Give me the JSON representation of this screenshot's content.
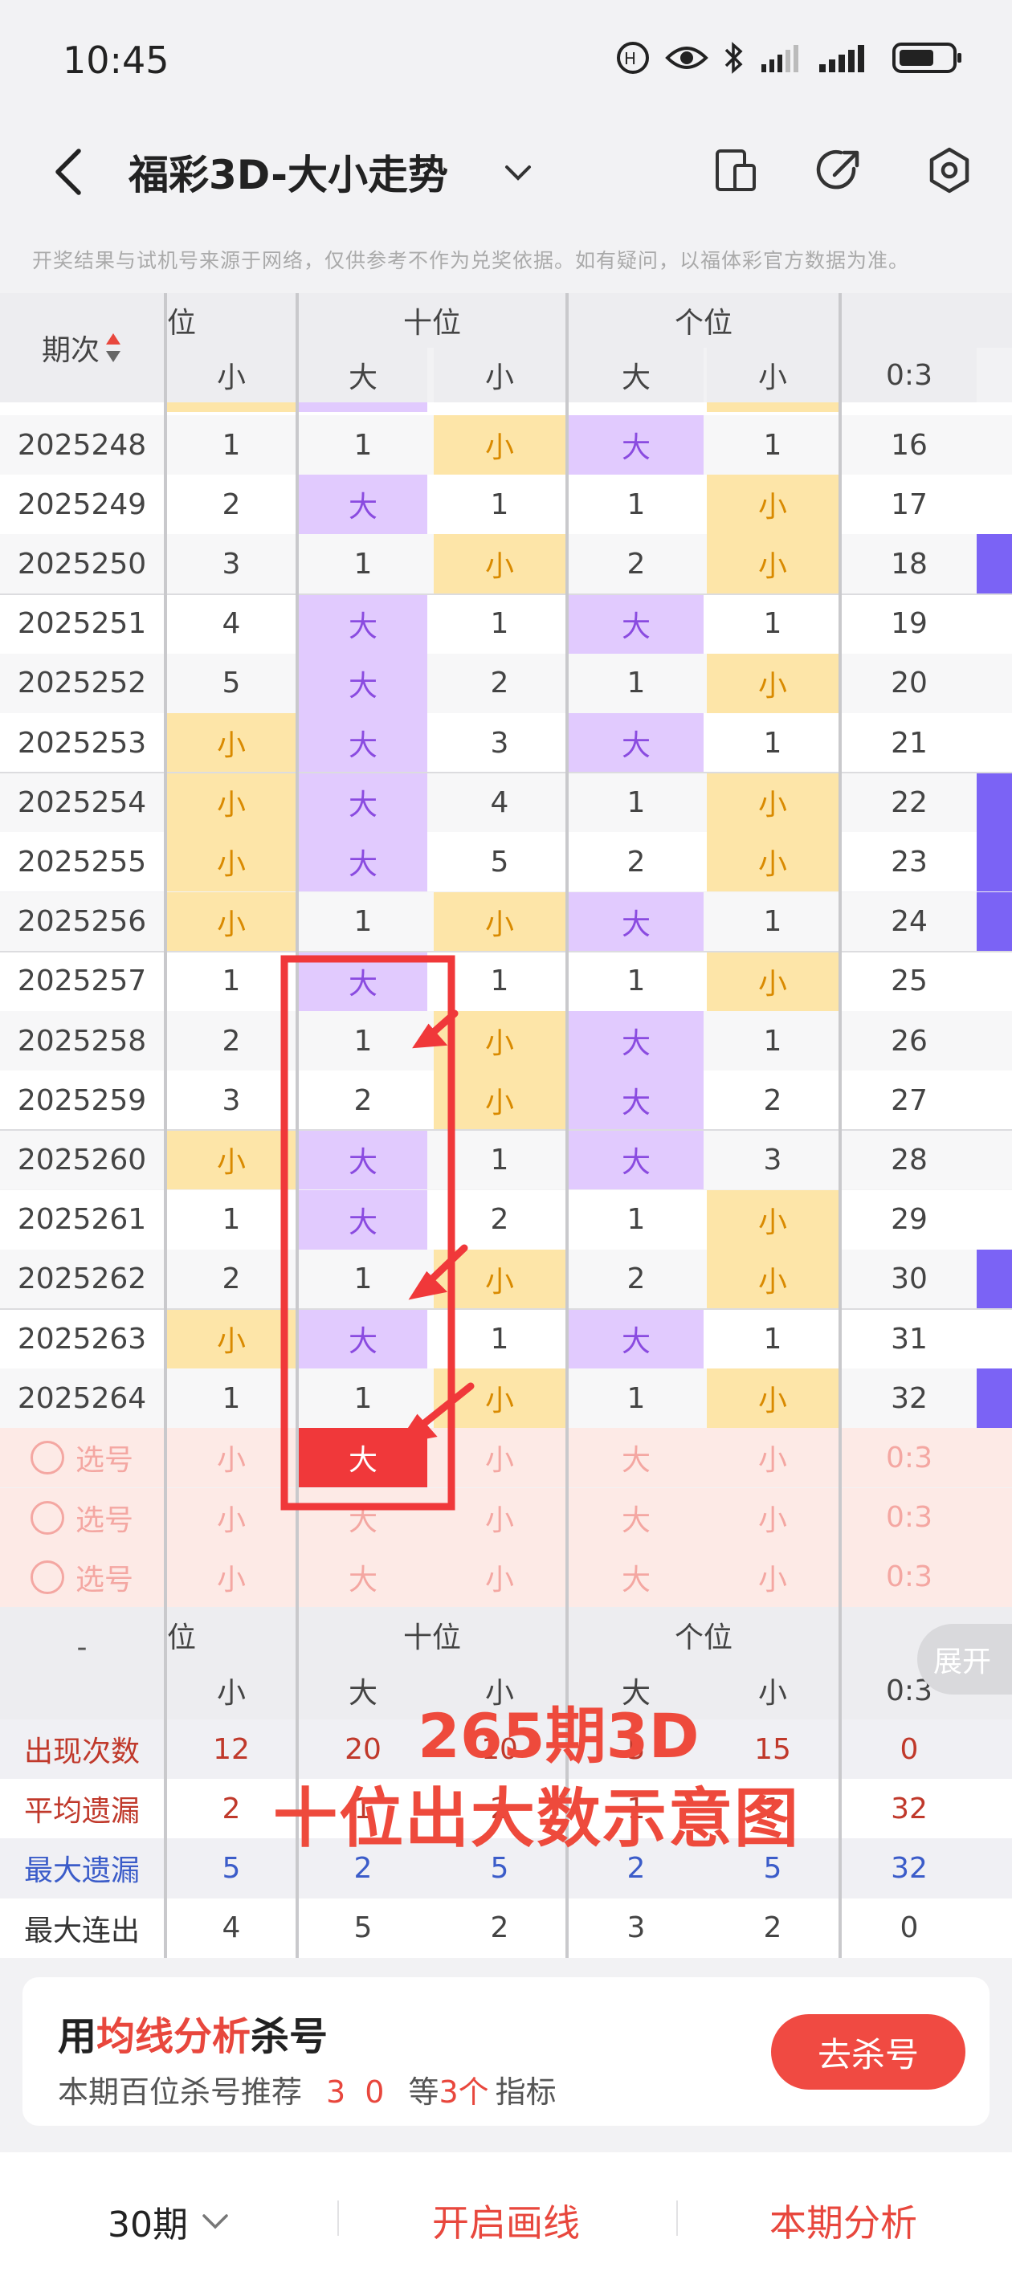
{
  "status": {
    "time": "10:45"
  },
  "header": {
    "title": "福彩3D-大小走势"
  },
  "notice": "开奖结果与试机号来源于网络，仅供参考不作为兑奖依据。如有疑问，以福体彩官方数据为准。",
  "table": {
    "period_label": "期次",
    "groups": [
      "位",
      "十位",
      "个位"
    ],
    "subheaders": [
      "小",
      "大",
      "小",
      "大",
      "小",
      "0:3"
    ],
    "rows": [
      {
        "period": "2025248",
        "c": [
          "1",
          "1",
          "小",
          "大",
          "1",
          "16"
        ]
      },
      {
        "period": "2025249",
        "c": [
          "2",
          "大",
          "1",
          "1",
          "小",
          "17"
        ]
      },
      {
        "period": "2025250",
        "c": [
          "3",
          "1",
          "小",
          "2",
          "小",
          "18"
        ]
      },
      {
        "period": "2025251",
        "c": [
          "4",
          "大",
          "1",
          "大",
          "1",
          "19"
        ]
      },
      {
        "period": "2025252",
        "c": [
          "5",
          "大",
          "2",
          "1",
          "小",
          "20"
        ]
      },
      {
        "period": "2025253",
        "c": [
          "小",
          "大",
          "3",
          "大",
          "1",
          "21"
        ]
      },
      {
        "period": "2025254",
        "c": [
          "小",
          "大",
          "4",
          "1",
          "小",
          "22"
        ]
      },
      {
        "period": "2025255",
        "c": [
          "小",
          "大",
          "5",
          "2",
          "小",
          "23"
        ]
      },
      {
        "period": "2025256",
        "c": [
          "小",
          "1",
          "小",
          "大",
          "1",
          "24"
        ]
      },
      {
        "period": "2025257",
        "c": [
          "1",
          "大",
          "1",
          "1",
          "小",
          "25"
        ]
      },
      {
        "period": "2025258",
        "c": [
          "2",
          "1",
          "小",
          "大",
          "1",
          "26"
        ]
      },
      {
        "period": "2025259",
        "c": [
          "3",
          "2",
          "小",
          "大",
          "2",
          "27"
        ]
      },
      {
        "period": "2025260",
        "c": [
          "小",
          "大",
          "1",
          "大",
          "3",
          "28"
        ]
      },
      {
        "period": "2025261",
        "c": [
          "1",
          "大",
          "2",
          "1",
          "小",
          "29"
        ]
      },
      {
        "period": "2025262",
        "c": [
          "2",
          "1",
          "小",
          "2",
          "小",
          "30"
        ]
      },
      {
        "period": "2025263",
        "c": [
          "小",
          "大",
          "1",
          "大",
          "1",
          "31"
        ]
      },
      {
        "period": "2025264",
        "c": [
          "1",
          "1",
          "小",
          "1",
          "小",
          "32"
        ]
      }
    ],
    "pick_label": "选号",
    "pick_values": [
      "小",
      "大",
      "小",
      "大",
      "小",
      "0:3"
    ],
    "expand_label": "展开",
    "footer_dash": "-",
    "stats": [
      {
        "label": "出现次数",
        "values": [
          "12",
          "20",
          "10",
          "5",
          "15",
          "0"
        ]
      },
      {
        "label": "平均遗漏",
        "values": [
          "2",
          "1",
          "2",
          "1",
          "1",
          "32"
        ]
      },
      {
        "label": "最大遗漏",
        "values": [
          "5",
          "2",
          "5",
          "2",
          "5",
          "32"
        ]
      },
      {
        "label": "最大连出",
        "values": [
          "4",
          "5",
          "2",
          "3",
          "2",
          "0"
        ]
      }
    ]
  },
  "annotation": {
    "line1": "265期3D",
    "line2": "十位出大数示意图"
  },
  "card": {
    "title_prefix": "用",
    "title_highlight": "均线分析",
    "title_suffix": "杀号",
    "sub_prefix": "本期百位杀号推荐",
    "sub_numbers": "3 0",
    "sub_mid": "等",
    "sub_count": "3个",
    "sub_suffix": "指标",
    "button": "去杀号"
  },
  "bottom": {
    "period": "30期",
    "draw": "开启画线",
    "analysis": "本期分析"
  },
  "colors": {
    "big_bg": "#e1cafe",
    "small_bg": "#fde5a8",
    "accent": "#e8473d"
  }
}
